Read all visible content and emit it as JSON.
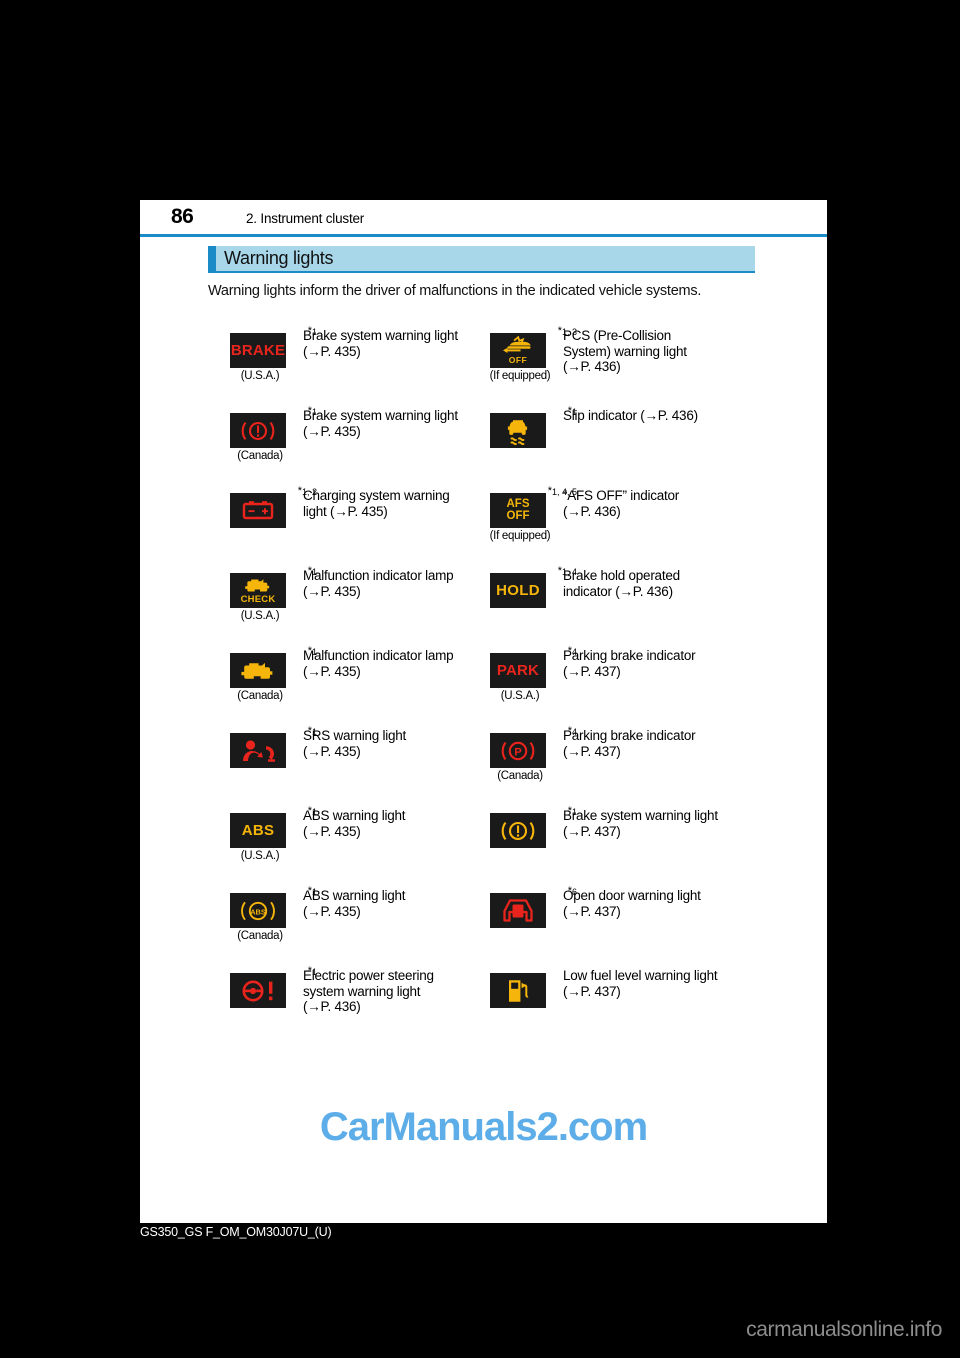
{
  "page": {
    "number": "86",
    "chapter": "2. Instrument cluster",
    "section_heading": "Warning lights",
    "intro": "Warning lights inform the driver of malfunctions in the indicated vehicle systems.",
    "footer_code": "GS350_GS F_OM_OM30J07U_(U)",
    "watermark": "CarManuals2.com",
    "site_mark": "carmanualsonline.info"
  },
  "colors": {
    "accent_blue": "#1a8bc6",
    "heading_bg": "#a8d7ea",
    "icon_bg": "#1a1a1a",
    "warning_red": "#e8241c",
    "warning_amber": "#f5b50a",
    "watermark_blue": "#5dade8"
  },
  "left_column": [
    {
      "footnote": "*1",
      "icon": "brake-text-warning-icon",
      "icon_text": "BRAKE",
      "region": "(U.S.A.)",
      "description": "Brake system warning light\n(→P. 435)"
    },
    {
      "footnote": "*1",
      "icon": "brake-circle-exclamation-icon",
      "icon_text": "",
      "region": "(Canada)",
      "description": "Brake system warning light\n(→P. 435)"
    },
    {
      "footnote": "*1, 2",
      "icon": "battery-charging-icon",
      "icon_text": "",
      "region": "",
      "description": "Charging system warning\nlight (→P. 435)"
    },
    {
      "footnote": "*1",
      "icon": "engine-check-icon",
      "icon_text": "CHECK",
      "region": "(U.S.A.)",
      "description": "Malfunction indicator lamp\n(→P. 435)"
    },
    {
      "footnote": "*1",
      "icon": "engine-icon",
      "icon_text": "",
      "region": "(Canada)",
      "description": "Malfunction indicator lamp\n(→P. 435)"
    },
    {
      "footnote": "*1",
      "icon": "srs-airbag-icon",
      "icon_text": "",
      "region": "",
      "description": "SRS warning light\n(→P. 435)"
    },
    {
      "footnote": "*1",
      "icon": "abs-text-icon",
      "icon_text": "ABS",
      "region": "(U.S.A.)",
      "description": "ABS warning light\n(→P. 435)"
    },
    {
      "footnote": "*1",
      "icon": "abs-circle-icon",
      "icon_text": "ABS",
      "region": "(Canada)",
      "description": "ABS warning light\n(→P. 435)"
    },
    {
      "footnote": "*1",
      "icon": "power-steering-icon",
      "icon_text": "",
      "region": "",
      "description": "Electric power steering\nsystem warning light\n(→P. 436)"
    }
  ],
  "right_column": [
    {
      "footnote": "*1, 3",
      "icon": "pcs-off-icon",
      "icon_text": "OFF",
      "region": "(If equipped)",
      "description": "PCS (Pre-Collision\nSystem) warning light\n(→P. 436)"
    },
    {
      "footnote": "*1",
      "icon": "slip-indicator-icon",
      "icon_text": "",
      "region": "",
      "description": "Slip indicator (→P. 436)"
    },
    {
      "footnote": "*1, 4, 5",
      "icon": "afs-off-icon",
      "icon_text": "AFS OFF",
      "region": "(If equipped)",
      "description": "“AFS OFF” indicator\n(→P. 436)"
    },
    {
      "footnote": "*1, 4",
      "icon": "brake-hold-icon",
      "icon_text": "HOLD",
      "region": "",
      "description": "Brake hold operated\nindicator (→P. 436)"
    },
    {
      "footnote": "*4",
      "icon": "park-text-icon",
      "icon_text": "PARK",
      "region": "(U.S.A.)",
      "description": "Parking brake indicator\n(→P. 437)"
    },
    {
      "footnote": "*4",
      "icon": "parking-brake-p-icon",
      "icon_text": "P",
      "region": "(Canada)",
      "description": "Parking brake indicator\n(→P. 437)"
    },
    {
      "footnote": "*1",
      "icon": "brake-circle-exclamation-amber-icon",
      "icon_text": "",
      "region": "",
      "description": "Brake system warning light\n(→P. 437)"
    },
    {
      "footnote": "*6",
      "icon": "open-door-icon",
      "icon_text": "",
      "region": "",
      "description": "Open door warning light\n(→P. 437)"
    },
    {
      "footnote": "",
      "icon": "low-fuel-icon",
      "icon_text": "",
      "region": "",
      "description": "Low fuel level warning light\n(→P. 437)"
    }
  ]
}
